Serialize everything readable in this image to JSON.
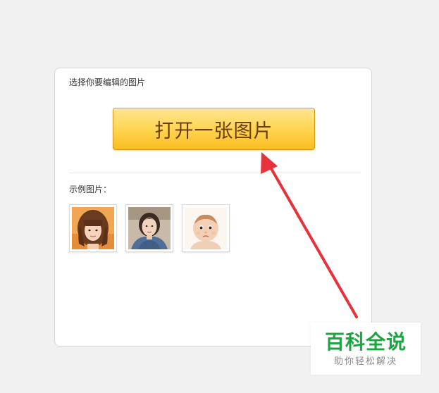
{
  "editor": {
    "prompt": "选择你要编辑的图片",
    "open_button_label": "打开一张图片",
    "examples_label": "示例图片："
  },
  "examples": [
    {
      "subject": "woman-with-bangs"
    },
    {
      "subject": "woman-selfie"
    },
    {
      "subject": "baby"
    }
  ],
  "annotation": {
    "arrow_color": "#e8313a"
  },
  "watermark": {
    "title": "百科全说",
    "subtitle": "助你轻松解决",
    "color": "#1ca541"
  }
}
